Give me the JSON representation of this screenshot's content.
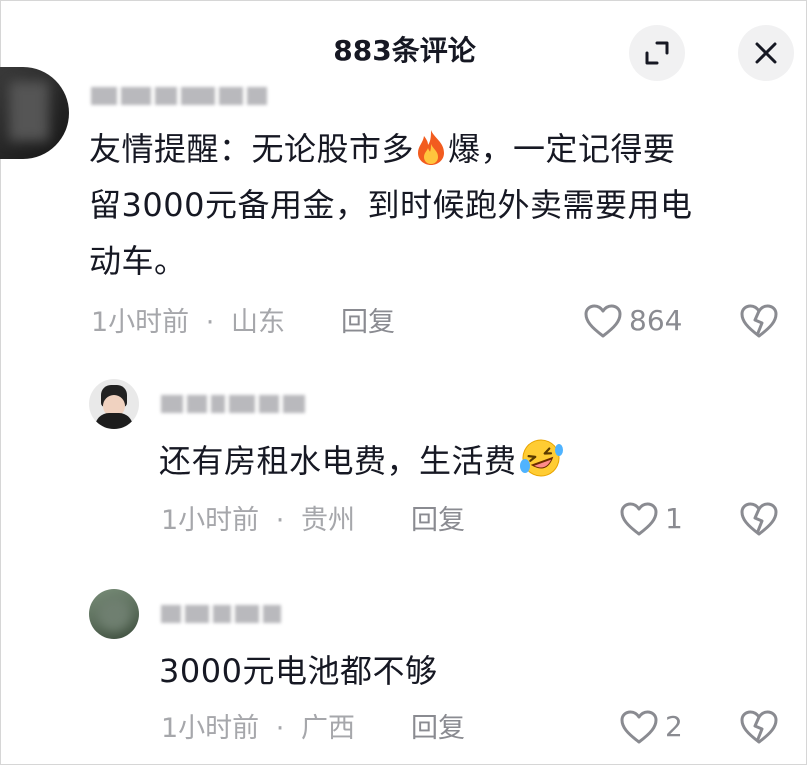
{
  "header": {
    "title": "883条评论",
    "collapse_icon": "collapse-icon",
    "close_icon": "close-icon"
  },
  "comments": [
    {
      "text_line1": "友情提醒：无论股市多",
      "text_line1_after": "爆，一定记得要",
      "text_line2": "留3000元备用金，到时候跑外卖需要用电",
      "text_line3": "动车。",
      "inline_emoji": "fire-emoji",
      "time": "1小时前",
      "separator": "·",
      "location": "山东",
      "reply_label": "回复",
      "likes": "864"
    },
    {
      "text": "还有房租水电费，生活费",
      "inline_emoji": "rolling-laughing-emoji",
      "time": "1小时前",
      "separator": "·",
      "location": "贵州",
      "reply_label": "回复",
      "likes": "1"
    },
    {
      "text": "3000元电池都不够",
      "time": "1小时前",
      "separator": "·",
      "location": "广西",
      "reply_label": "回复",
      "likes": "2"
    }
  ],
  "colors": {
    "text_primary": "#161823",
    "text_meta": "#a6a7ab",
    "header_button_bg": "#f1f1f2"
  }
}
